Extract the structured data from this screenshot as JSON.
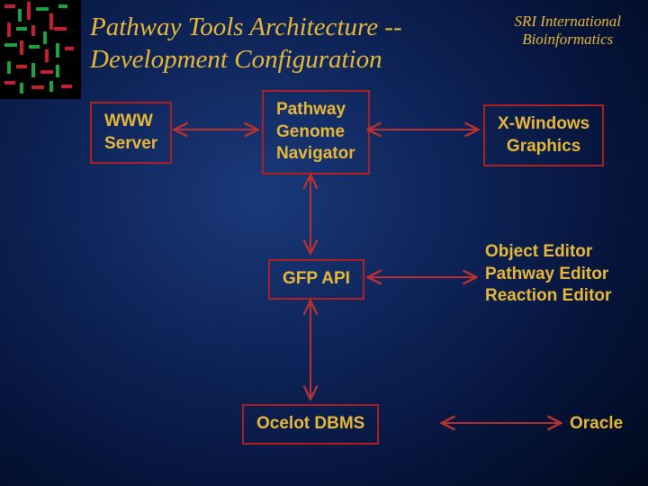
{
  "title_line1": "Pathway Tools Architecture --",
  "title_line2": "Development Configuration",
  "affiliation_line1": "SRI International",
  "affiliation_line2": "Bioinformatics",
  "boxes": {
    "www_server_line1": "WWW",
    "www_server_line2": "Server",
    "navigator_line1": "Pathway",
    "navigator_line2": "Genome",
    "navigator_line3": "Navigator",
    "xwindows_line1": "X-Windows",
    "xwindows_line2": "Graphics",
    "gfp_api": "GFP API",
    "editors_line1": "Object Editor",
    "editors_line2": "Pathway Editor",
    "editors_line3": "Reaction Editor",
    "ocelot": "Ocelot DBMS",
    "oracle": "Oracle"
  },
  "colors": {
    "accent_text": "#e8b838",
    "box_border": "#b02020",
    "arrow": "#b83030"
  }
}
